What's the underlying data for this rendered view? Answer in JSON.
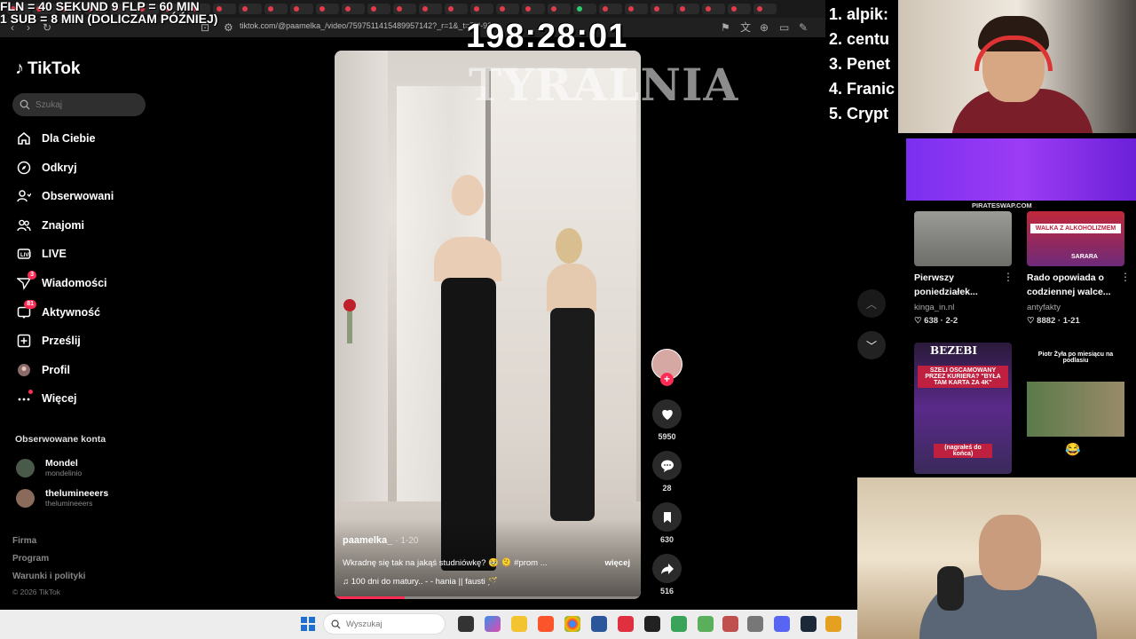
{
  "overlay": {
    "ticker_line1": "FLN = 40 SEKUND 9 FLP = 60 MIN",
    "ticker_line2": "1 SUB = 8 MIN (DOLICZAM PÓŹNIEJ)",
    "timer": "198:28:01",
    "brand": "TYRALNIA"
  },
  "browser": {
    "url": "tiktok.com/@paamelka_/video/7597511415489957142?_r=1&_t=ZN-93..."
  },
  "tiktok": {
    "logo": "TikTok",
    "search_placeholder": "Szukaj",
    "nav": [
      {
        "label": "Dla Ciebie",
        "icon": "home-icon"
      },
      {
        "label": "Odkryj",
        "icon": "compass-icon"
      },
      {
        "label": "Obserwowani",
        "icon": "following-icon"
      },
      {
        "label": "Znajomi",
        "icon": "friends-icon"
      },
      {
        "label": "LIVE",
        "icon": "live-icon"
      },
      {
        "label": "Wiadomości",
        "icon": "messages-icon",
        "badge": "3"
      },
      {
        "label": "Aktywność",
        "icon": "activity-icon",
        "badge": "81"
      },
      {
        "label": "Prześlij",
        "icon": "upload-icon"
      },
      {
        "label": "Profil",
        "icon": "profile-icon"
      },
      {
        "label": "Więcej",
        "icon": "more-icon"
      }
    ],
    "followed_title": "Obserwowane konta",
    "followed": [
      {
        "name": "Mondel",
        "handle": "mondelinio"
      },
      {
        "name": "thelumineeers",
        "handle": "thelumineeers"
      }
    ],
    "footer": [
      "Firma",
      "Program",
      "Warunki i polityki"
    ],
    "copyright": "© 2026 TikTok"
  },
  "video": {
    "author": "paamelka_",
    "date": "· 1-20",
    "caption": "Wkradnę się tak na jakąś studniówkę? 🥹 🫠 #prom ...",
    "more": "więcej",
    "music": "♫  100 dni do matury.. - - hania || fausti 🪄",
    "progress": 0.23
  },
  "actions": {
    "likes": "5950",
    "comments": "28",
    "saves": "630",
    "shares": "516"
  },
  "ranking": [
    "1. alpik:",
    "2. centu",
    "3. Penet",
    "4. Franic",
    "5. Crypt"
  ],
  "right_panel": {
    "ad_label": "PIRATESWAP.COM",
    "recs": [
      {
        "title": "Pierwszy poniedziałek...",
        "author": "kinga_in.nl",
        "stats": "♡ 638 · 2-2"
      },
      {
        "title": "Rado opowiada o codziennej walce...",
        "author": "antyfakty",
        "stats": "♡ 8882 · 1-21",
        "thumb_text": "WALKA Z ALKOHOLIZMEM",
        "thumb_sub": "SARARA"
      },
      {
        "thumb_text": "SZELI OSCAMOWANY PRZEZ KURIERA? \"BYŁA TAM KARTA ZA 4K\"",
        "thumb_brand": "BEZEBI",
        "thumb_sub": "(nagrałeś do końca)"
      },
      {
        "thumb_text": "Piotr Żyła po miesiącu na podlasiu",
        "emoji": "😂"
      }
    ]
  },
  "taskbar": {
    "search_placeholder": "Wyszukaj"
  }
}
